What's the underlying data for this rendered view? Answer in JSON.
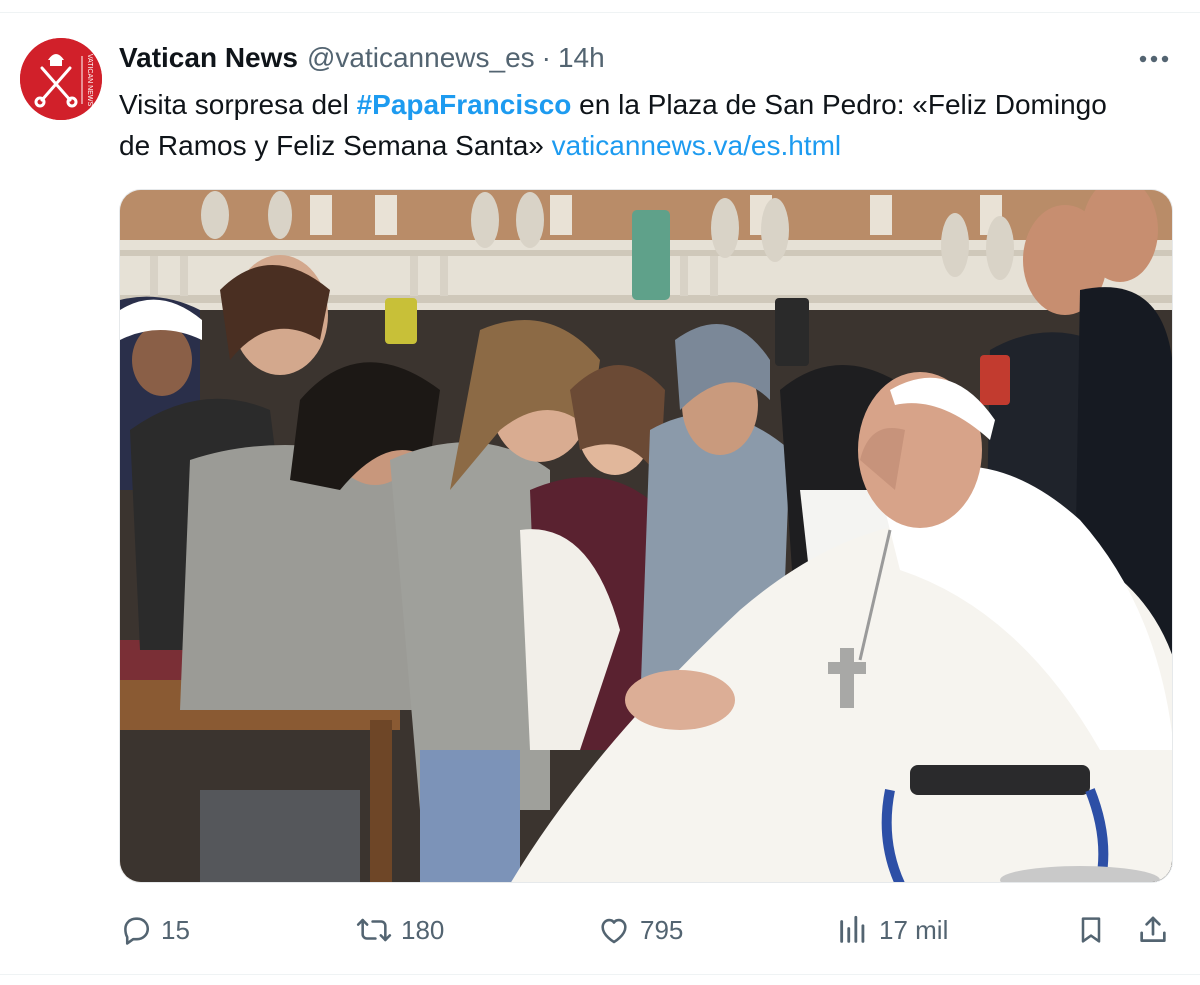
{
  "tweet": {
    "author_name": "Vatican News",
    "handle": "@vaticannews_es",
    "separator": "·",
    "time": "14h",
    "text": {
      "part1": "Visita sorpresa del ",
      "hashtag": "#PapaFrancisco",
      "part2": " en la Plaza de San Pedro: «Feliz Domingo de Ramos y Feliz Semana Santa» ",
      "link": "vaticannews.va/es.html"
    },
    "avatar": {
      "logo_text": "VATICAN NEWS"
    },
    "media_alt": "Pope Francis greeting women and nuns in St. Peter's Square"
  },
  "actions": {
    "replies": "15",
    "reposts": "180",
    "likes": "795",
    "views": "17 mil"
  },
  "colors": {
    "accent": "#1d9bf0",
    "secondary_text": "#536471",
    "brand_red": "#d1202a"
  },
  "icons": [
    "ellipsis-icon",
    "reply-icon",
    "repost-icon",
    "like-icon",
    "views-icon",
    "bookmark-icon",
    "share-icon"
  ]
}
